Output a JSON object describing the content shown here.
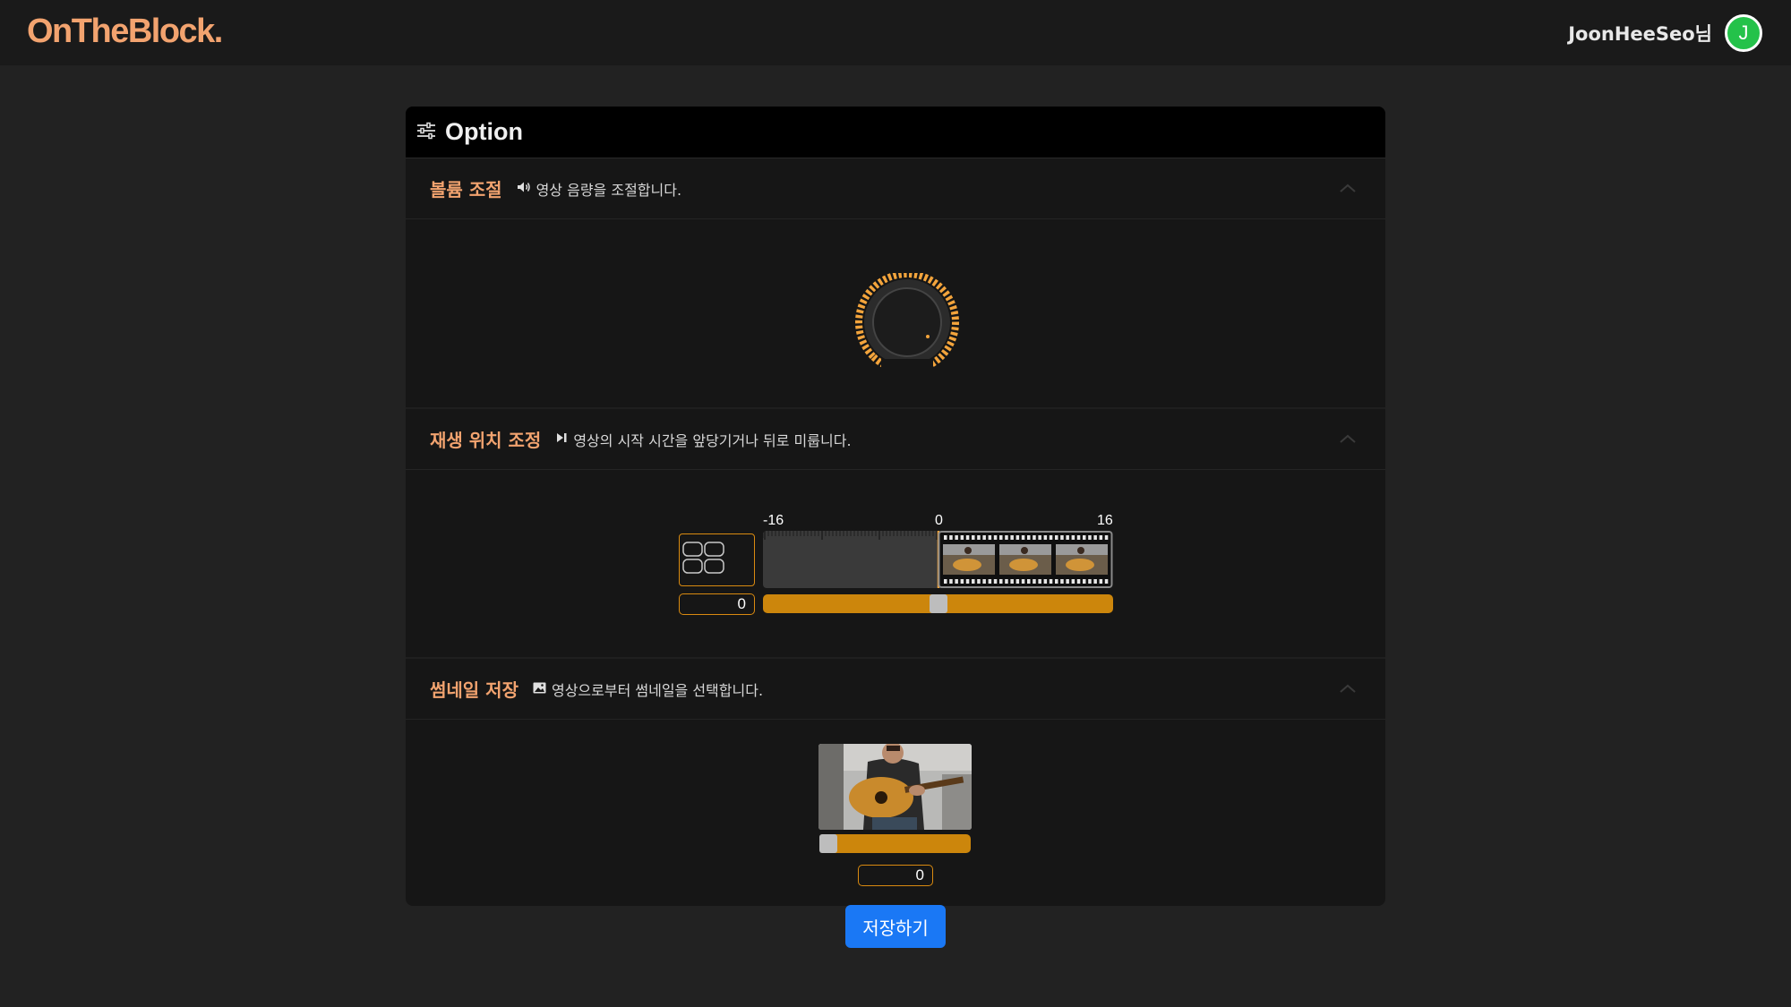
{
  "header": {
    "logo": "OnTheBlock.",
    "username": "JoonHeeSeo님",
    "avatar_initial": "J",
    "avatar_color": "#24c24a"
  },
  "panel": {
    "title": "Option",
    "title_icon": "sliders-icon"
  },
  "sections": [
    {
      "title": "볼륨 조절",
      "icon": "speaker-icon",
      "description": "영상 음량을 조절합니다.",
      "control": "volume-knob"
    },
    {
      "title": "재생 위치 조정",
      "icon": "play-skip-icon",
      "description": "영상의 시작 시간을 앞당기거나 뒤로 미룹니다.",
      "control": "offset-timeline",
      "timeline": {
        "min_label": "-16",
        "zero_label": "0",
        "max_label": "16",
        "offset_value": "0",
        "slider_fraction": 0.5
      }
    },
    {
      "title": "썸네일 저장",
      "icon": "image-icon",
      "description": "영상으로부터 썸네일을 선택합니다.",
      "control": "thumbnail-picker",
      "thumbnail": {
        "frame_value": "0",
        "slider_fraction": 0.0
      }
    }
  ],
  "save_button": "저장하기",
  "colors": {
    "accent": "#f2a36f",
    "slider": "#cc860c",
    "primary_button": "#1a78f5"
  }
}
